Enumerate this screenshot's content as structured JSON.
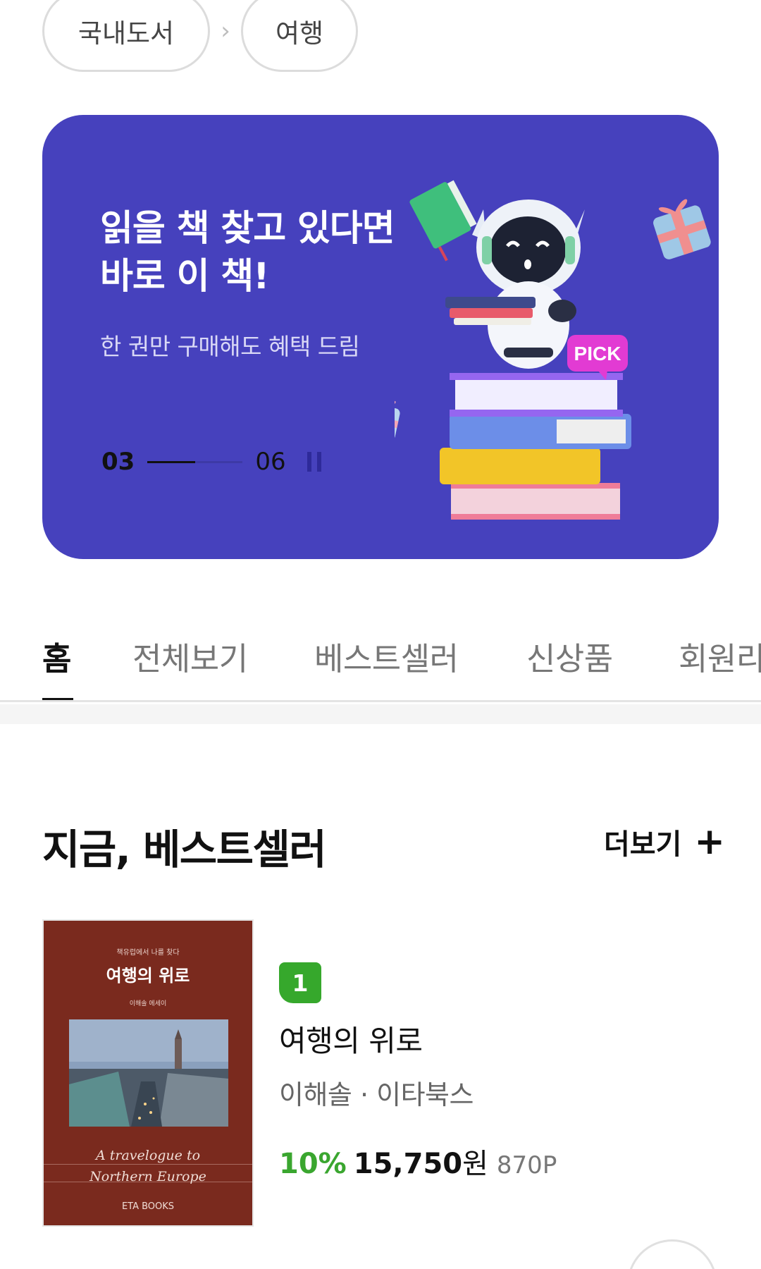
{
  "breadcrumb": {
    "items": [
      {
        "label": "국내도서"
      },
      {
        "label": "여행"
      }
    ],
    "separator": "›"
  },
  "banner": {
    "title_line1": "읽을 책 찾고 있다면",
    "title_line2": "바로 이 책!",
    "subtitle": "한 권만 구매해도 혜택 드림",
    "pick_label": "PICK",
    "current": "03",
    "total": "06",
    "progress": 0.5,
    "background_color": "#4641bd"
  },
  "tabs": [
    {
      "label": "홈",
      "active": true
    },
    {
      "label": "전체보기"
    },
    {
      "label": "베스트셀러"
    },
    {
      "label": "신상품"
    },
    {
      "label": "회원리"
    }
  ],
  "section": {
    "title": "지금, 베스트셀러",
    "more_label": "더보기",
    "more_icon": "plus-icon"
  },
  "bestseller": {
    "rank": "1",
    "title": "여행의 위로",
    "meta": "이해솔 · 이타북스",
    "discount": "10%",
    "price": "15,750",
    "currency": "원",
    "points": "870P",
    "accent_color": "#36a82c",
    "cover": {
      "top_text": "책유럽에서 나를 찾다",
      "title": "여행의 위로",
      "author": "이해솔 에세이",
      "script_line1": "A travelogue to",
      "script_line2": "Northern Europe",
      "publisher": "ETA BOOKS"
    }
  }
}
